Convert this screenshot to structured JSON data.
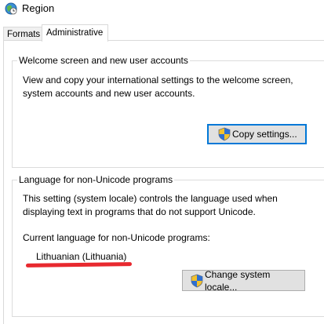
{
  "window": {
    "title": "Region"
  },
  "tabs": [
    {
      "label": "Formats",
      "active": false
    },
    {
      "label": "Administrative",
      "active": true
    }
  ],
  "welcome_group": {
    "title": "Welcome screen and new user accounts",
    "description_line1": "View and copy your international settings to the welcome screen,",
    "description_line2": "system accounts and new user accounts.",
    "button_label": "Copy settings..."
  },
  "unicode_group": {
    "title": "Language for non-Unicode programs",
    "description_line1": "This setting (system locale) controls the language used when",
    "description_line2": "displaying text in programs that do not support Unicode.",
    "current_label": "Current language for non-Unicode programs:",
    "current_value": "Lithuanian (Lithuania)",
    "button_label": "Change system locale..."
  },
  "colors": {
    "default_button_border": "#0078d7",
    "annotation_underline": "#e8292f",
    "button_face": "#e1e1e1"
  },
  "icons": {
    "app": "globe-clock-icon",
    "buttons": "uac-shield-icon"
  }
}
